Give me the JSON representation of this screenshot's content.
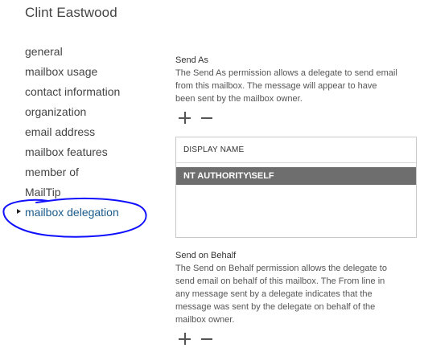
{
  "header": {
    "title": "Clint Eastwood"
  },
  "nav": {
    "items": [
      {
        "label": "general"
      },
      {
        "label": "mailbox usage"
      },
      {
        "label": "contact information"
      },
      {
        "label": "organization"
      },
      {
        "label": "email address"
      },
      {
        "label": "mailbox features"
      },
      {
        "label": "member of"
      },
      {
        "label": "MailTip"
      },
      {
        "label": "mailbox delegation"
      }
    ],
    "active_index": 8,
    "annotation_color": "#1010ff"
  },
  "send_as": {
    "heading": "Send As",
    "description_lines": [
      "The Send As permission allows a delegate to send email",
      "from this mailbox. The message will appear to have",
      "been sent by the mailbox owner."
    ],
    "add_icon": "plus-icon",
    "remove_icon": "minus-icon",
    "list": {
      "column_header": "DISPLAY NAME",
      "rows": [
        "NT AUTHORITY\\SELF"
      ],
      "selected_row_color": "#6e6e6e"
    }
  },
  "send_on_behalf": {
    "heading": "Send on Behalf",
    "description_lines": [
      "The Send on Behalf permission allows the delegate to",
      "send email on behalf of this mailbox. The From line in",
      "any message sent by a delegate indicates that the",
      "message was sent by the delegate on behalf of the",
      "mailbox owner."
    ],
    "add_icon": "plus-icon",
    "remove_icon": "minus-icon"
  }
}
